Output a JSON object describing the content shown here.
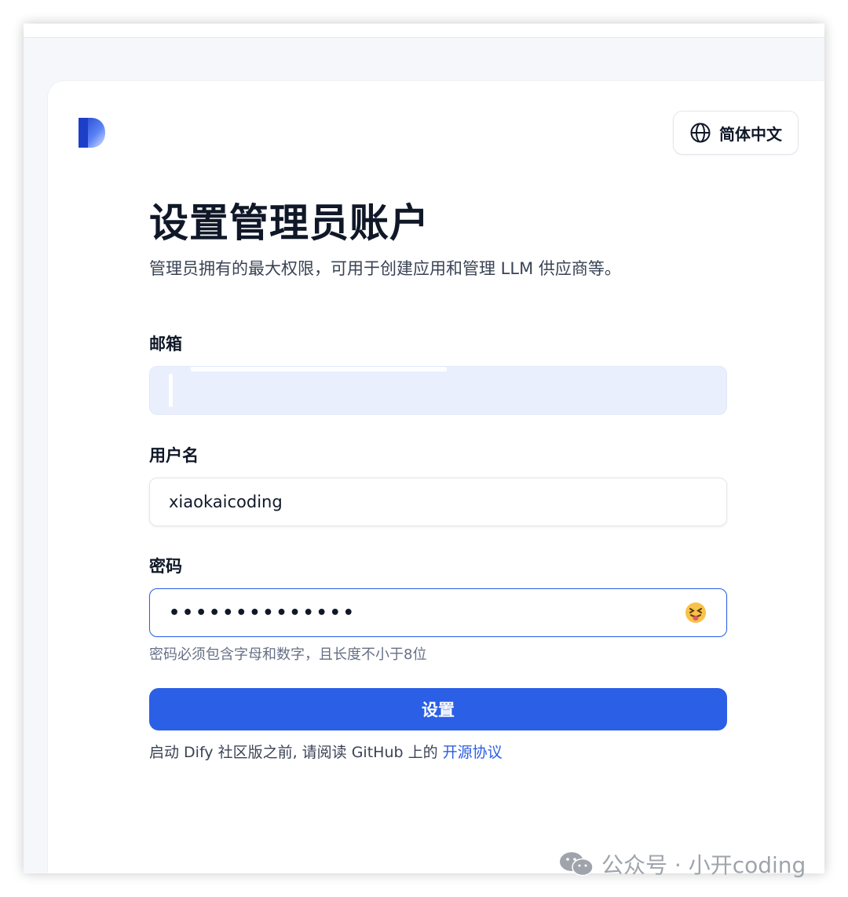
{
  "header": {
    "language_label": "简体中文"
  },
  "form": {
    "title": "设置管理员账户",
    "subtitle": "管理员拥有的最大权限，可用于创建应用和管理 LLM 供应商等。",
    "email": {
      "label": "邮箱",
      "value": ""
    },
    "username": {
      "label": "用户名",
      "value": "xiaokaicoding"
    },
    "password": {
      "label": "密码",
      "masked_value": "••••••••••••••",
      "hint": "密码必须包含字母和数字，且长度不小于8位"
    },
    "submit_label": "设置",
    "footer_prefix": "启动 Dify 社区版之前, 请阅读 GitHub 上的",
    "footer_link": "开源协议"
  },
  "watermark": {
    "text": "公众号 · 小开coding"
  },
  "colors": {
    "primary": "#2b5fe6",
    "text": "#101828",
    "muted": "#667085"
  }
}
